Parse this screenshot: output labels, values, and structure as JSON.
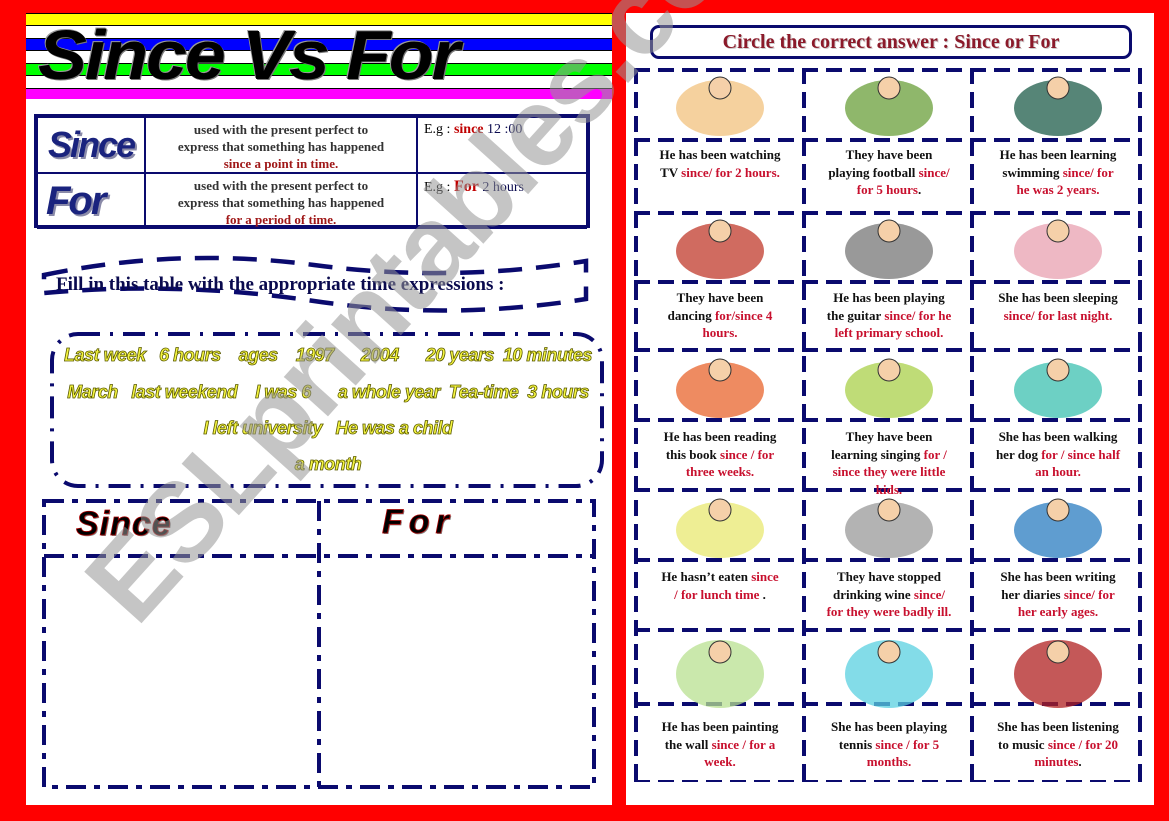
{
  "colors": {
    "frame": "#ff0000",
    "navy": "#0a0a6e",
    "answer_red": "#c8102e",
    "word_yellow": "#f5f540",
    "stripes": [
      "#ffff00",
      "#0000ff",
      "#00ff00",
      "#ff00ff"
    ]
  },
  "left_page": {
    "title": "Since Vs For",
    "definitions": [
      {
        "word": "Since",
        "description_lines": [
          "used with the present perfect to",
          "express that something has happened"
        ],
        "description_emphasis": "since a point  in time.",
        "example_prefix": "E.g : ",
        "example_keyword": "since",
        "example_rest": " 12 :00"
      },
      {
        "word": "For",
        "description_lines": [
          "used with the present perfect to",
          "express that something has happened"
        ],
        "description_emphasis": "for a period of time.",
        "example_prefix": "E.g : ",
        "example_keyword": "For",
        "example_rest": " 2  hours"
      }
    ],
    "fill_instruction": "Fill in this table with the appropriate time expressions :",
    "word_bank_lines": [
      "Last week   6 hours    ages    1997      2004      20 years  10 minutes",
      "March   last weekend    I was 6      a whole year  Tea-time  3 hours",
      "I left university   He was a child",
      "a month"
    ],
    "sort_table_headers": [
      "Since",
      "For"
    ]
  },
  "right_page": {
    "instruction": "Circle the correct answer : Since or For",
    "exercises": [
      {
        "picture": "boy-watching-tv",
        "lines": [
          [
            "He has been  watching",
            ""
          ],
          [
            "TV ",
            "since/ for 2 hours."
          ]
        ]
      },
      {
        "picture": "kids-playing-football",
        "lines": [
          [
            "They have been",
            ""
          ],
          [
            "playing football ",
            "since/"
          ],
          [
            "",
            "for 5 hours",
            "."
          ]
        ]
      },
      {
        "picture": "swimmer",
        "lines": [
          [
            "He  has been learning",
            ""
          ],
          [
            "swimming  ",
            "since/ for"
          ],
          [
            "",
            "he was 2 years."
          ]
        ]
      },
      {
        "picture": "couple-dancing",
        "lines": [
          [
            "They have been",
            ""
          ],
          [
            "dancing ",
            "for/since  4"
          ],
          [
            "",
            "hours."
          ]
        ]
      },
      {
        "picture": "man-playing-guitar",
        "lines": [
          [
            "He has been playing",
            ""
          ],
          [
            "the guitar ",
            "since/ for  he"
          ],
          [
            "",
            "left primary school."
          ]
        ]
      },
      {
        "picture": "girl-sleeping",
        "lines": [
          [
            "She has been sleeping",
            ""
          ],
          [
            "",
            "since/ for last night."
          ]
        ]
      },
      {
        "picture": "boy-reading-book",
        "lines": [
          [
            "He  has been reading",
            ""
          ],
          [
            "this book ",
            "since / for"
          ],
          [
            "",
            "three weeks."
          ]
        ]
      },
      {
        "picture": "kids-singing",
        "lines": [
          [
            "They have been",
            ""
          ],
          [
            "learning  singing ",
            "for /"
          ],
          [
            "",
            "since they were little"
          ],
          [
            "",
            "kids."
          ]
        ]
      },
      {
        "picture": "girl-walking-dog",
        "lines": [
          [
            "She  has been walking",
            ""
          ],
          [
            "her dog ",
            "for / since half"
          ],
          [
            "",
            "an hour."
          ]
        ]
      },
      {
        "picture": "boy-eating",
        "lines": [
          [
            "He hasn’t  eaten ",
            "since"
          ],
          [
            "",
            "/ for lunch time",
            " ."
          ]
        ]
      },
      {
        "picture": "elderly-couple-wine",
        "lines": [
          [
            "They have stopped",
            ""
          ],
          [
            "drinking wine ",
            "since/"
          ],
          [
            "",
            "for they were badly ill."
          ]
        ]
      },
      {
        "picture": "girl-writing-diary",
        "lines": [
          [
            "She has been writing",
            ""
          ],
          [
            "her diaries ",
            "since/ for"
          ],
          [
            "",
            "her early ages."
          ]
        ]
      },
      {
        "picture": "man-painting-wall",
        "lines": [
          [
            "He has been painting",
            ""
          ],
          [
            "the wall ",
            "since / for a"
          ],
          [
            "",
            "week."
          ]
        ]
      },
      {
        "picture": "girl-with-tennis-racket",
        "lines": [
          [
            "She has been playing",
            ""
          ],
          [
            "tennis ",
            "since / for    5"
          ],
          [
            "",
            "months."
          ]
        ]
      },
      {
        "picture": "girl-listening-music",
        "lines": [
          [
            "She has been listening",
            ""
          ],
          [
            "to music ",
            "since / for  20"
          ],
          [
            "",
            "minutes",
            "."
          ]
        ]
      }
    ]
  },
  "watermark": "ESLprintables.com"
}
